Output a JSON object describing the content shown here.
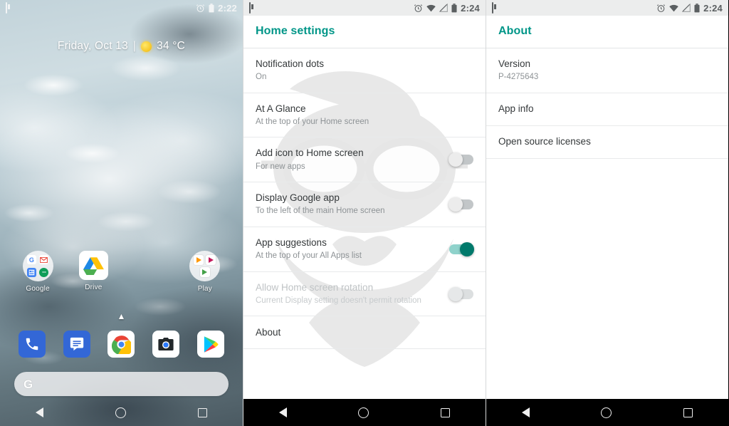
{
  "home": {
    "statusbar": {
      "notification_icon": "notification-icon",
      "alarm_icon": "alarm-clock-icon",
      "battery_icon": "battery-icon",
      "time": "2:22"
    },
    "weather": {
      "date": "Friday, Oct 13",
      "separator": "|",
      "condition_icon": "sun-icon",
      "temperature": "34 °C"
    },
    "apps": [
      {
        "label": "Google",
        "type": "folder",
        "icon": "google-folder-icon"
      },
      {
        "label": "Drive",
        "type": "app",
        "icon": "drive-icon"
      },
      {
        "label": "",
        "type": "blank",
        "icon": ""
      },
      {
        "label": "Play",
        "type": "folder",
        "icon": "play-folder-icon"
      }
    ],
    "page_chevron": "▲",
    "dock": [
      {
        "name": "Phone",
        "icon": "phone-icon"
      },
      {
        "name": "Messages",
        "icon": "messages-icon"
      },
      {
        "name": "Chrome",
        "icon": "chrome-icon"
      },
      {
        "name": "Camera",
        "icon": "camera-icon"
      },
      {
        "name": "Play Store",
        "icon": "play-store-icon"
      }
    ],
    "search": {
      "logo": "G",
      "placeholder": ""
    },
    "nav": {
      "back": "back-icon",
      "home": "home-icon",
      "recents": "recents-icon"
    }
  },
  "home_settings": {
    "statusbar": {
      "notification_icon": "notification-icon",
      "alarm_icon": "alarm-clock-icon",
      "wifi_icon": "wifi-icon",
      "signal_icon": "no-sim-icon",
      "battery_icon": "battery-icon",
      "time": "2:24"
    },
    "title": "Home settings",
    "accent_color": "#009688",
    "rows": [
      {
        "title": "Notification dots",
        "sub": "On",
        "toggle": "none"
      },
      {
        "title": "At A Glance",
        "sub": "At the top of your Home screen",
        "toggle": "none"
      },
      {
        "title": "Add icon to Home screen",
        "sub": "For new apps",
        "toggle": "off"
      },
      {
        "title": "Display Google app",
        "sub": "To the left of the main Home screen",
        "toggle": "off"
      },
      {
        "title": "App suggestions",
        "sub": "At the top of your All Apps list",
        "toggle": "on"
      },
      {
        "title": "Allow Home screen rotation",
        "sub": "Current Display setting doesn't permit rotation",
        "toggle": "disabled"
      },
      {
        "title": "About",
        "sub": "",
        "toggle": "none"
      }
    ]
  },
  "about": {
    "statusbar": {
      "notification_icon": "notification-icon",
      "alarm_icon": "alarm-clock-icon",
      "wifi_icon": "wifi-icon",
      "signal_icon": "no-sim-icon",
      "battery_icon": "battery-icon",
      "time": "2:24"
    },
    "title": "About",
    "accent_color": "#009688",
    "rows": [
      {
        "title": "Version",
        "sub": "P-4275643"
      },
      {
        "title": "App info",
        "sub": ""
      },
      {
        "title": "Open source licenses",
        "sub": ""
      }
    ]
  }
}
